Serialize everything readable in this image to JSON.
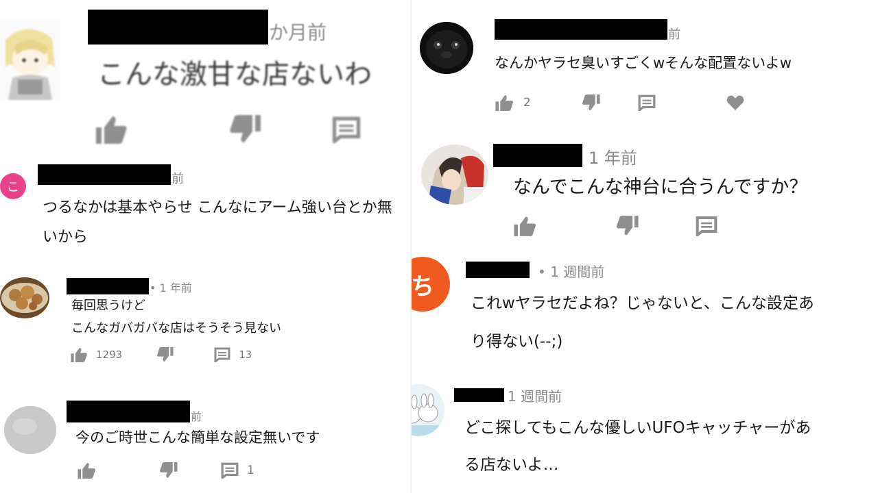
{
  "colors": {
    "icon_gray": "#8f8f8f",
    "meta_gray": "#8a8a8a",
    "redaction": "#000000",
    "pink_avatar": "#e9418b",
    "orange_avatar": "#f05a1e"
  },
  "icons": [
    "thumbs-up-icon",
    "thumbs-down-icon",
    "reply-icon",
    "heart-icon"
  ],
  "left_comments": [
    {
      "avatar": "anime-character-avatar",
      "time": "か月前",
      "lines": [
        "こんな激甘な店ないわ"
      ],
      "likes": "",
      "replies": ""
    },
    {
      "avatar": "letter-avatar",
      "avatar_letter": "こ",
      "time": "前",
      "lines": [
        "つるなかは基本やらせ こんなにアーム強い台とか無",
        "いから"
      ],
      "likes": "",
      "replies": ""
    },
    {
      "avatar": "food-photo-avatar",
      "time": "• 1 年前",
      "lines": [
        "毎回思うけど",
        "こんなガバガバな店はそうそう見ない"
      ],
      "likes": "1293",
      "replies": "13"
    },
    {
      "avatar": "gray-default-avatar",
      "time": "前",
      "lines": [
        "今のご時世こんな簡単な設定無いです"
      ],
      "likes": "",
      "replies": "1"
    }
  ],
  "right_comments": [
    {
      "avatar": "black-pug-avatar",
      "time": "前",
      "lines": [
        "なんかヤラセ臭いすごくwそんな配置ないよw"
      ],
      "likes": "2",
      "replies": ""
    },
    {
      "avatar": "illustration-avatar",
      "time": "1 年前",
      "lines": [
        "なんでこんな神台に合うんですか？"
      ],
      "likes": "",
      "replies": ""
    },
    {
      "avatar": "letter-avatar",
      "avatar_letter": "ち",
      "time": "• 1 週間前",
      "lines": [
        "これwヤラセだよね？じゃないと、こんな設定あ",
        "り得ない(--;)"
      ],
      "likes": "",
      "replies": ""
    },
    {
      "avatar": "rabbit-illustration-avatar",
      "time": "1 週間前",
      "lines": [
        "どこ探してもこんな優しいUFOキャッチャーがあ",
        "る店ないよ…"
      ],
      "likes": "",
      "replies": ""
    }
  ]
}
